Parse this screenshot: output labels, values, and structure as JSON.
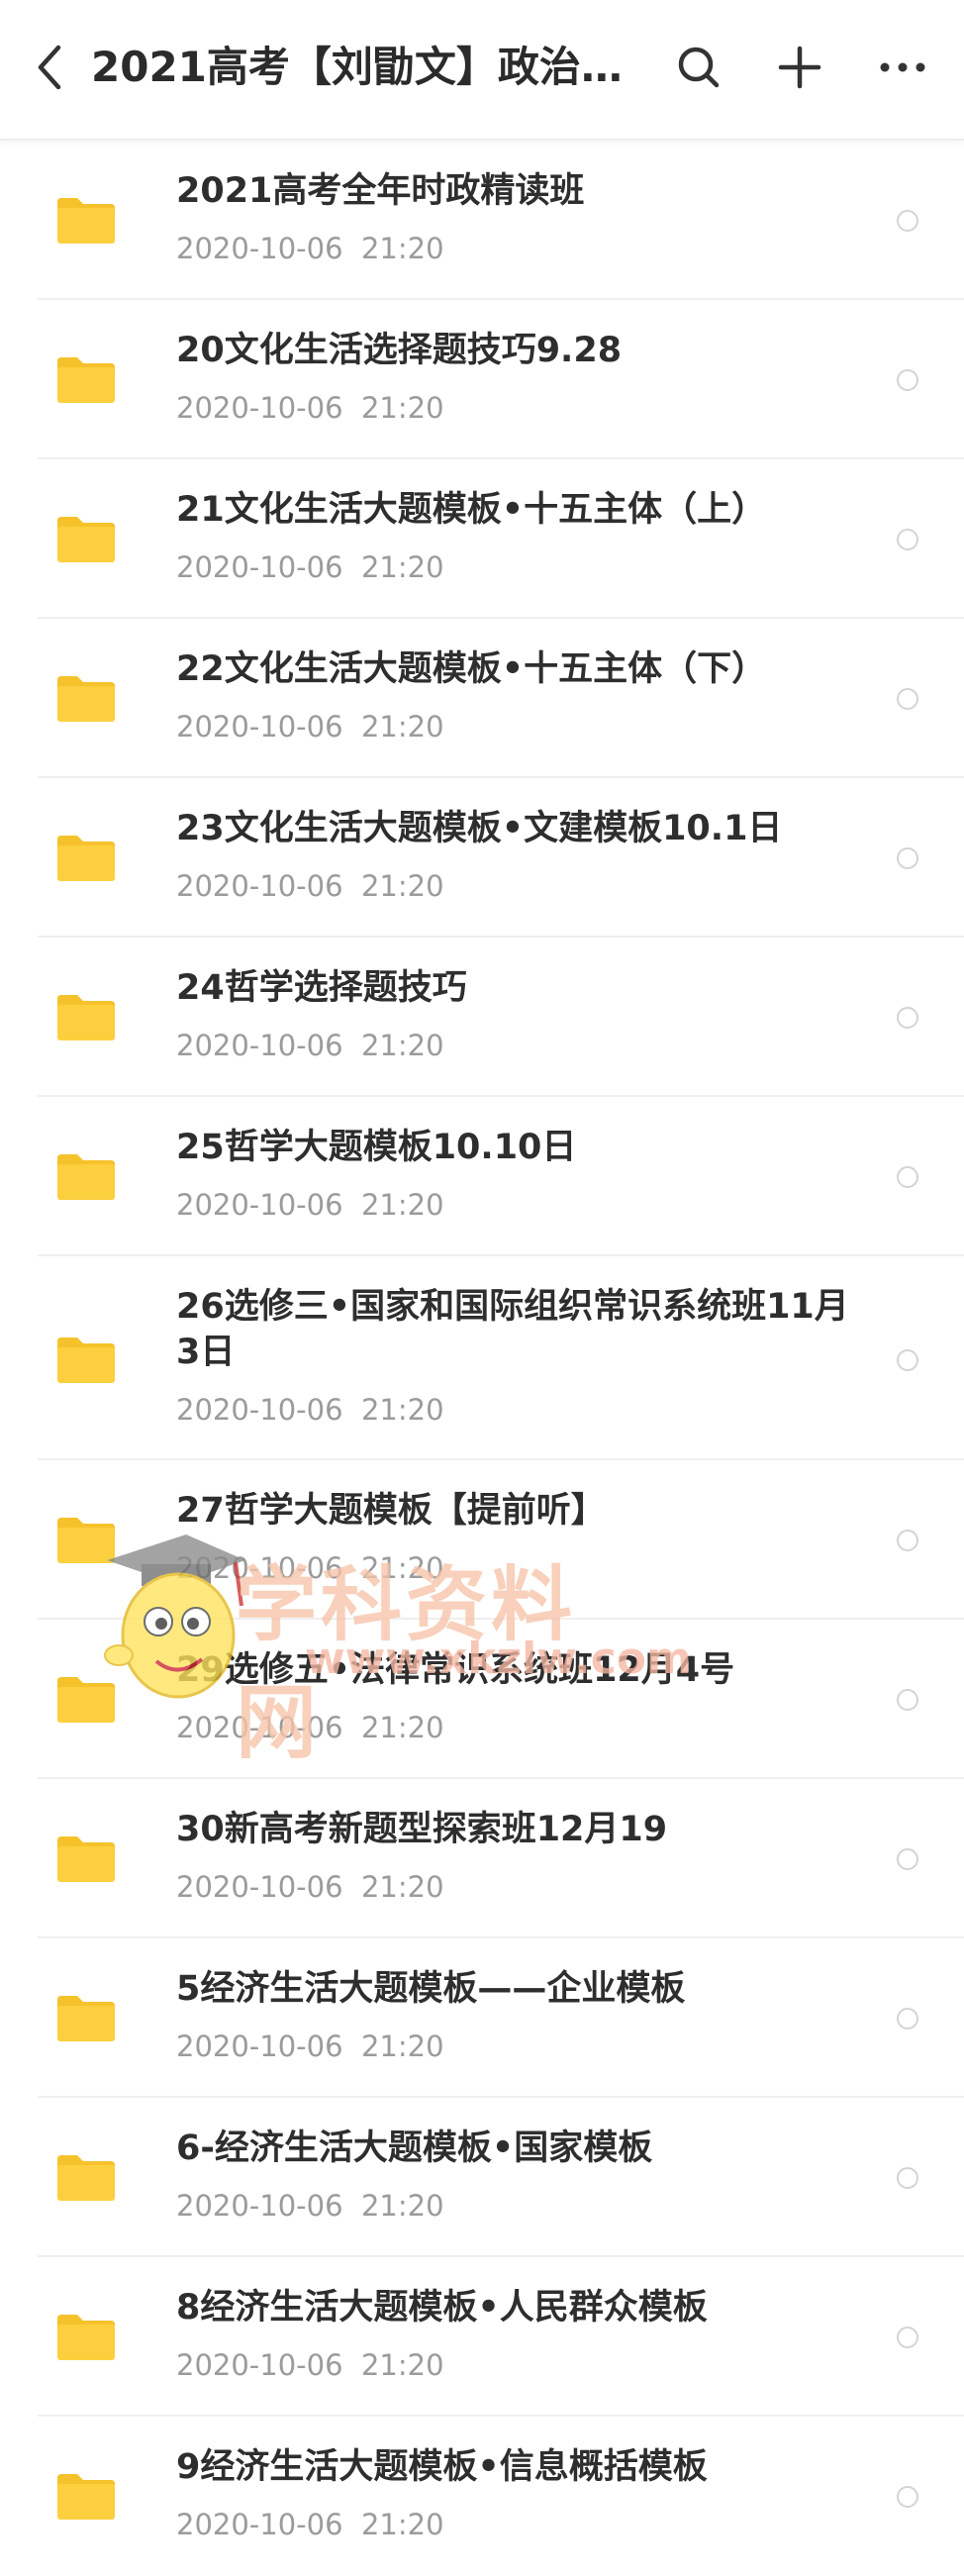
{
  "header": {
    "title": "2021高考【刘勖文】政治一…",
    "back_icon": "chevron-left-icon",
    "search_icon": "search-icon",
    "add_icon": "plus-icon",
    "more_icon": "more-horizontal-icon"
  },
  "colors": {
    "folder": "#FCCF3E",
    "folder_tab": "#F6C22B",
    "title_text": "#2E2E2E",
    "date_text": "#9B9B9B",
    "divider": "#EFEFEF"
  },
  "files": [
    {
      "name": "2021高考全年时政精读班",
      "date": "2020-10-06  21:20"
    },
    {
      "name": "20文化生活选择题技巧9.28",
      "date": "2020-10-06  21:20"
    },
    {
      "name": "21文化生活大题模板•十五主体（上）",
      "date": "2020-10-06  21:20"
    },
    {
      "name": "22文化生活大题模板•十五主体（下）",
      "date": "2020-10-06  21:20"
    },
    {
      "name": "23文化生活大题模板•文建模板10.1日",
      "date": "2020-10-06  21:20"
    },
    {
      "name": "24哲学选择题技巧",
      "date": "2020-10-06  21:20"
    },
    {
      "name": "25哲学大题模板10.10日",
      "date": "2020-10-06  21:20"
    },
    {
      "name": "26选修三•国家和国际组织常识系统班11月3日",
      "date": "2020-10-06  21:20"
    },
    {
      "name": "27哲学大题模板【提前听】",
      "date": "2020-10-06  21:20"
    },
    {
      "name": "29选修五•法律常识系统班12月4号",
      "date": "2020-10-06  21:20"
    },
    {
      "name": "30新高考新题型探索班12月19",
      "date": "2020-10-06  21:20"
    },
    {
      "name": "5经济生活大题模板——企业模板",
      "date": "2020-10-06  21:20"
    },
    {
      "name": "6-经济生活大题模板•国家模板",
      "date": "2020-10-06  21:20"
    },
    {
      "name": "8经济生活大题模板•人民群众模板",
      "date": "2020-10-06  21:20"
    },
    {
      "name": "9经济生活大题模板•信息概括模板",
      "date": "2020-10-06  21:20"
    }
  ],
  "watermark": {
    "text": "学科资料网",
    "url": "www.xkzlw.com"
  }
}
